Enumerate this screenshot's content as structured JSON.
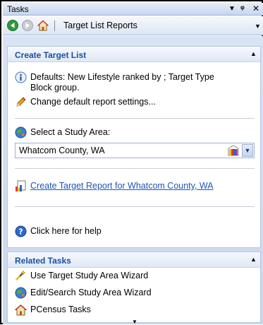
{
  "window": {
    "title": "Tasks"
  },
  "nav": {
    "title": "Target List Reports"
  },
  "target_panel": {
    "title": "Create Target List",
    "defaults_line1": "Defaults: New Lifestyle ranked by ; Target Type",
    "defaults_line2": "Block group.",
    "change_settings": "Change default report settings...",
    "select_area_label": "Select a Study Area:",
    "study_area_value": "Whatcom County, WA",
    "create_report_link": "Create Target Report for Whatcom County, WA",
    "help_text": "Click here for help"
  },
  "related_panel": {
    "title": "Related Tasks",
    "items": [
      {
        "label": "Use Target Study Area Wizard",
        "icon": "wand-icon"
      },
      {
        "label": "Edit/Search Study Area Wizard",
        "icon": "globe-icon"
      },
      {
        "label": "PCensus Tasks",
        "icon": "home-icon"
      }
    ]
  },
  "colors": {
    "link": "#1f55b4",
    "section_title": "#1a4fa0"
  }
}
